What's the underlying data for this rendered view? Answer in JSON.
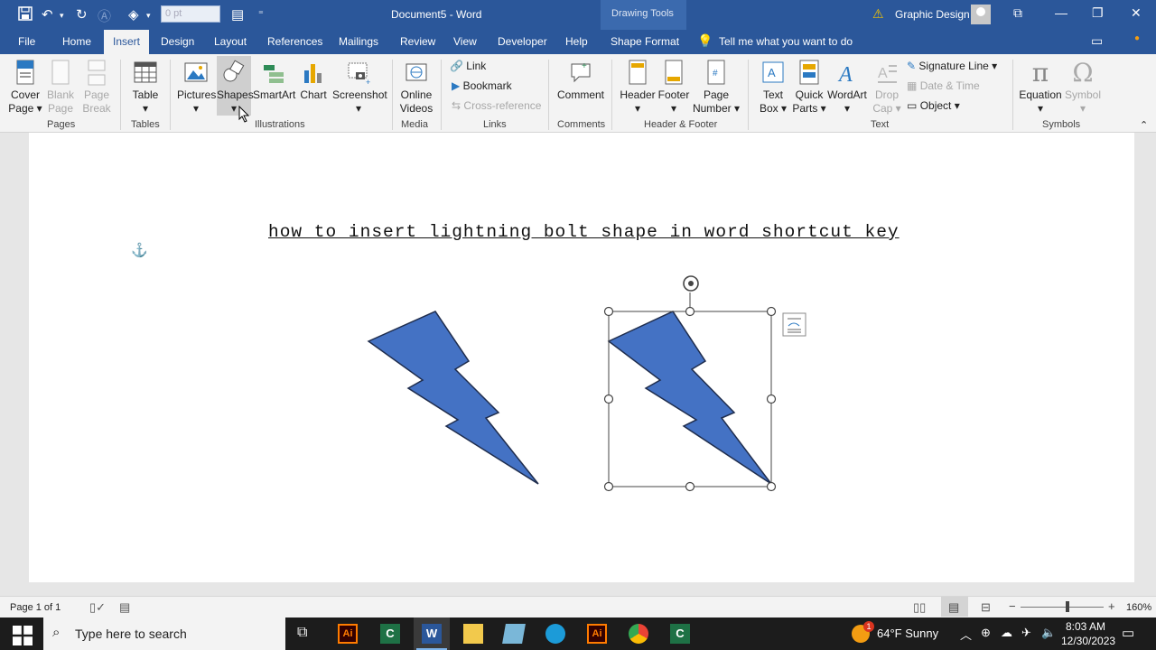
{
  "titlebar": {
    "title": "Document5 - Word",
    "context_group": "Drawing Tools",
    "user": "Graphic Design",
    "size_field": "0 pt"
  },
  "tabs": [
    "File",
    "Home",
    "Insert",
    "Design",
    "Layout",
    "References",
    "Mailings",
    "Review",
    "View",
    "Developer",
    "Help",
    "Shape Format"
  ],
  "active_tab": "Insert",
  "tell_me": "Tell me what you want to do",
  "ribbon": {
    "pages": {
      "cover_1": "Cover",
      "cover_2": "Page",
      "blank_1": "Blank",
      "blank_2": "Page",
      "break_1": "Page",
      "break_2": "Break",
      "group": "Pages"
    },
    "tables": {
      "table": "Table",
      "group": "Tables"
    },
    "illustrations": {
      "pictures": "Pictures",
      "shapes": "Shapes",
      "smartart": "SmartArt",
      "chart": "Chart",
      "screenshot": "Screenshot",
      "group": "Illustrations"
    },
    "media": {
      "online_1": "Online",
      "online_2": "Videos",
      "group": "Media"
    },
    "links": {
      "link": "Link",
      "bookmark": "Bookmark",
      "crossref": "Cross-reference",
      "group": "Links"
    },
    "comments": {
      "comment": "Comment",
      "group": "Comments"
    },
    "header_footer": {
      "header": "Header",
      "footer": "Footer",
      "pagenum_1": "Page",
      "pagenum_2": "Number",
      "group": "Header & Footer"
    },
    "text": {
      "textbox_1": "Text",
      "textbox_2": "Box",
      "quick_1": "Quick",
      "quick_2": "Parts",
      "wordart": "WordArt",
      "dropcap_1": "Drop",
      "dropcap_2": "Cap",
      "signature": "Signature Line",
      "datetime": "Date & Time",
      "object": "Object",
      "group": "Text"
    },
    "symbols": {
      "equation": "Equation",
      "symbol": "Symbol",
      "group": "Symbols"
    }
  },
  "document": {
    "heading": "how to insert lightning bolt shape in word shortcut key",
    "shape_color": "#4472c4",
    "shape_outline": "#1f2d4d"
  },
  "status": {
    "page": "Page 1 of 1",
    "zoom": "160%"
  },
  "taskbar": {
    "search_placeholder": "Type here to search",
    "weather": "64°F  Sunny",
    "time": "8:03 AM",
    "date": "12/30/2023",
    "notif_badge": "1"
  }
}
